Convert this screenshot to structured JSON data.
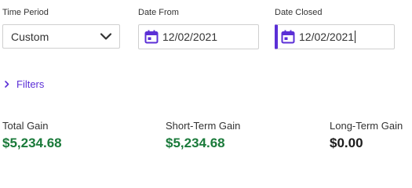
{
  "time_period": {
    "label": "Time Period",
    "selected": "Custom",
    "icon": "chevron-down-icon"
  },
  "date_from": {
    "label": "Date From",
    "value": "12/02/2021",
    "icon": "calendar-icon"
  },
  "date_closed": {
    "label": "Date Closed",
    "value": "12/02/2021",
    "icon": "calendar-icon",
    "focused": true
  },
  "filters": {
    "label": "Filters",
    "icon": "chevron-right-icon"
  },
  "summary": [
    {
      "label": "Total Gain",
      "value": "$5,234.68",
      "status": "gain"
    },
    {
      "label": "Short-Term Gain",
      "value": "$5,234.68",
      "status": "gain"
    },
    {
      "label": "Long-Term Gain",
      "value": "$0.00",
      "status": "neutral"
    }
  ],
  "colors": {
    "accent": "#5b2fd6",
    "gain": "#1a7a3a",
    "neutral": "#1c1c1c",
    "border": "#cfcfcf"
  }
}
